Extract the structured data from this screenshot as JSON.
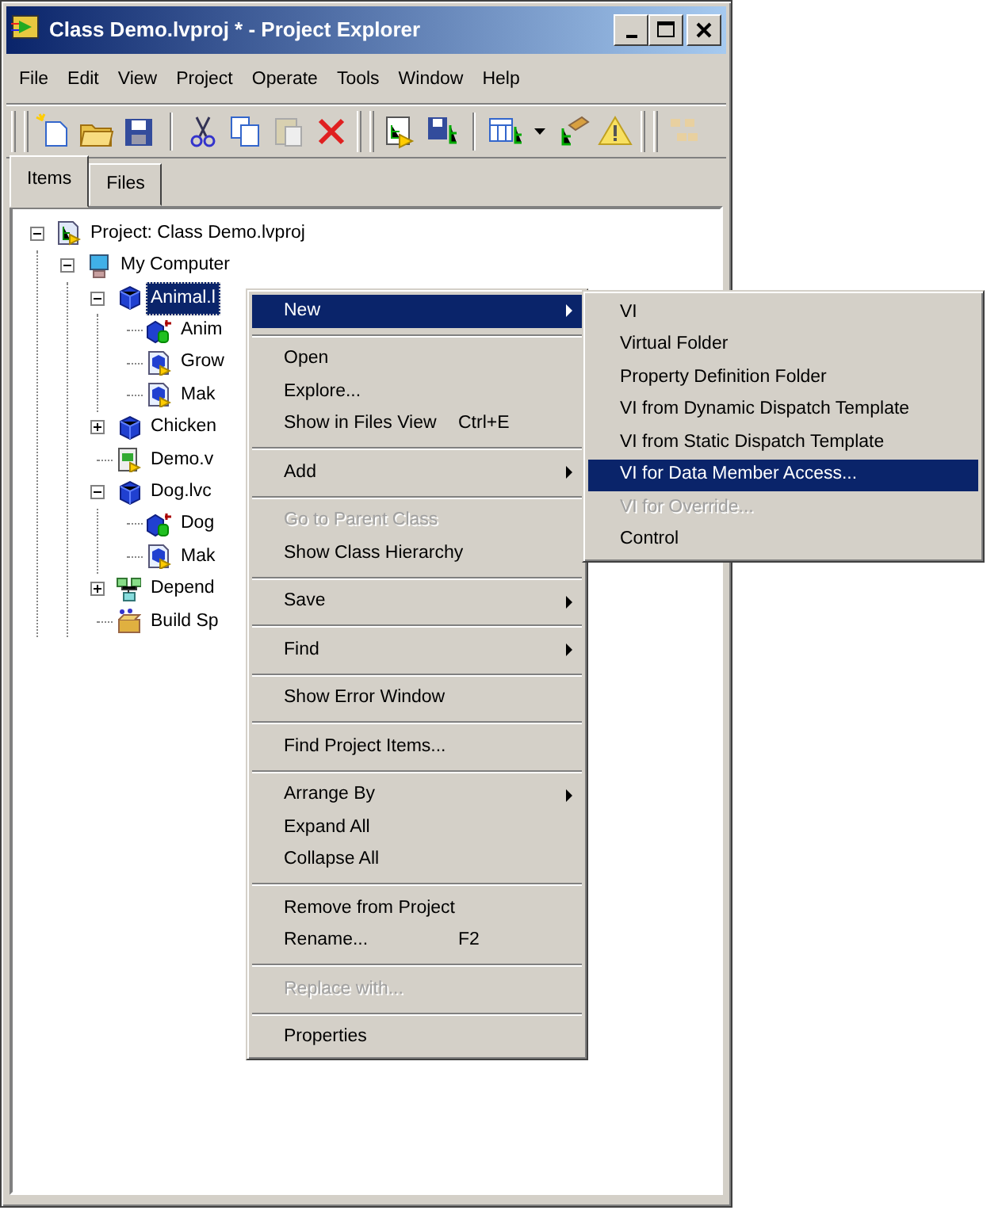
{
  "window": {
    "title": "Class Demo.lvproj * - Project Explorer"
  },
  "menu_bar": [
    "File",
    "Edit",
    "View",
    "Project",
    "Operate",
    "Tools",
    "Window",
    "Help"
  ],
  "tabs": [
    {
      "label": "Items",
      "selected": true
    },
    {
      "label": "Files",
      "selected": false
    }
  ],
  "tree": [
    {
      "label": "Project: Class Demo.lvproj",
      "kind": "project",
      "expanded": true,
      "selected": false,
      "children": [
        {
          "label": "My Computer",
          "kind": "computer",
          "expanded": true,
          "selected": false,
          "children": [
            {
              "label": "Animal.l",
              "kind": "class",
              "expanded": true,
              "selected": true,
              "children": [
                {
                  "label": "Anim",
                  "kind": "data",
                  "selected": false
                },
                {
                  "label": "Grow",
                  "kind": "method",
                  "selected": false
                },
                {
                  "label": "Mak",
                  "kind": "method",
                  "selected": false
                }
              ]
            },
            {
              "label": "Chicken",
              "kind": "class",
              "expanded": false,
              "selected": false
            },
            {
              "label": "Demo.v",
              "kind": "vi",
              "selected": false
            },
            {
              "label": "Dog.lvc",
              "kind": "class",
              "expanded": true,
              "selected": false,
              "children": [
                {
                  "label": "Dog",
                  "kind": "data",
                  "selected": false
                },
                {
                  "label": "Mak",
                  "kind": "method",
                  "selected": false
                }
              ]
            },
            {
              "label": "Depend",
              "kind": "dependencies",
              "expanded": false,
              "selected": false
            },
            {
              "label": "Build Sp",
              "kind": "build",
              "selected": false
            }
          ]
        }
      ]
    }
  ],
  "context_menu": [
    {
      "kind": "item",
      "label": "New",
      "submenu": true,
      "selected": true,
      "disabled": false
    },
    {
      "kind": "separator"
    },
    {
      "kind": "item",
      "label": "Open",
      "selected": false,
      "disabled": false
    },
    {
      "kind": "item",
      "label": "Explore...",
      "selected": false,
      "disabled": false
    },
    {
      "kind": "item",
      "label": "Show in Files View",
      "shortcut": "Ctrl+E",
      "selected": false,
      "disabled": false
    },
    {
      "kind": "separator"
    },
    {
      "kind": "item",
      "label": "Add",
      "submenu": true,
      "selected": false,
      "disabled": false
    },
    {
      "kind": "separator"
    },
    {
      "kind": "item",
      "label": "Go to Parent Class",
      "selected": false,
      "disabled": true
    },
    {
      "kind": "item",
      "label": "Show Class Hierarchy",
      "selected": false,
      "disabled": false
    },
    {
      "kind": "separator"
    },
    {
      "kind": "item",
      "label": "Save",
      "submenu": true,
      "selected": false,
      "disabled": false
    },
    {
      "kind": "separator"
    },
    {
      "kind": "item",
      "label": "Find",
      "submenu": true,
      "selected": false,
      "disabled": false
    },
    {
      "kind": "separator"
    },
    {
      "kind": "item",
      "label": "Show Error Window",
      "selected": false,
      "disabled": false
    },
    {
      "kind": "separator"
    },
    {
      "kind": "item",
      "label": "Find Project Items...",
      "selected": false,
      "disabled": false
    },
    {
      "kind": "separator"
    },
    {
      "kind": "item",
      "label": "Arrange By",
      "submenu": true,
      "selected": false,
      "disabled": false
    },
    {
      "kind": "item",
      "label": "Expand All",
      "selected": false,
      "disabled": false
    },
    {
      "kind": "item",
      "label": "Collapse All",
      "selected": false,
      "disabled": false
    },
    {
      "kind": "separator"
    },
    {
      "kind": "item",
      "label": "Remove from Project",
      "selected": false,
      "disabled": false
    },
    {
      "kind": "item",
      "label": "Rename...",
      "shortcut": "F2",
      "selected": false,
      "disabled": false
    },
    {
      "kind": "separator"
    },
    {
      "kind": "item",
      "label": "Replace with...",
      "selected": false,
      "disabled": true
    },
    {
      "kind": "separator"
    },
    {
      "kind": "item",
      "label": "Properties",
      "selected": false,
      "disabled": false
    }
  ],
  "submenu": [
    {
      "label": "VI",
      "selected": false,
      "disabled": false
    },
    {
      "label": "Virtual Folder",
      "selected": false,
      "disabled": false
    },
    {
      "label": "Property Definition Folder",
      "selected": false,
      "disabled": false
    },
    {
      "label": "VI from Dynamic Dispatch Template",
      "selected": false,
      "disabled": false
    },
    {
      "label": "VI from Static Dispatch Template",
      "selected": false,
      "disabled": false
    },
    {
      "label": "VI for Data Member Access...",
      "selected": true,
      "disabled": false
    },
    {
      "label": "VI for Override...",
      "selected": false,
      "disabled": true
    },
    {
      "label": "Control",
      "selected": false,
      "disabled": false
    }
  ]
}
